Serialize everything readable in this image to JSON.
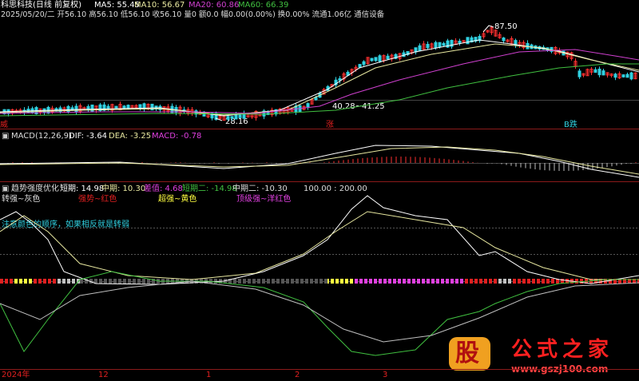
{
  "header": {
    "title": "科思科技(日线 前复权)",
    "ma5": "MA5: 55.45",
    "ma10": "MA10: 56.67",
    "ma20": "MA20: 60.86",
    "ma60": "MA60: 66.39",
    "info": "2025/05/20/二 开56.10 高56.10 低56.10 收56.10 量0 额0.0 幅0.00(0.00%) 换0.00% 流通1.06亿 通信设备"
  },
  "price_panel": {
    "high_label": "87.50",
    "mid_label": "40.28~41.25",
    "low_label": "28.16",
    "sig1": "威",
    "sig2": "涨",
    "sig3": "B跌"
  },
  "macd_panel": {
    "title": "MACD(12,26,9)",
    "dif": "DIF: -3.64",
    "dea": "DEA: -3.25",
    "macd": "MACD: -0.78"
  },
  "trend_panel": {
    "title": "趋势强度优化",
    "short": "短期: 14.98",
    "mid": "中期: 10.30",
    "diff": "差值: 4.68",
    "short2": "短期二: -14.98",
    "mid2": "中期二: -10.30",
    "levels": "100.00 : 200.00",
    "legend1": "转强~灰色",
    "legend2": "强势~红色",
    "legend3": "超强~黄色",
    "legend4": "顶级强~洋红色",
    "note": "注意颜色的顺序，如果相反就是转弱"
  },
  "x_axis": [
    "2024年",
    "12",
    "1",
    "2",
    "3"
  ],
  "watermark": {
    "logo": "股",
    "name": "公式之家",
    "url": "www.gszj100.com"
  },
  "colors": {
    "ma5": "#ffffff",
    "ma10": "#e8e8a0",
    "ma20": "#d040d0",
    "ma60": "#40c040",
    "up": "#ff3030",
    "down": "#30d0e0",
    "magenta": "#e040e0",
    "yellow": "#ffff40",
    "gray": "#c0c0c0",
    "red": "#e02020"
  },
  "chart_data": {
    "type": "line",
    "title": "科思科技(日线 前复权)",
    "x": [
      "2024年",
      "12",
      "1",
      "2",
      "3"
    ],
    "series": [
      {
        "name": "MA5",
        "values": [
          55.45
        ]
      },
      {
        "name": "MA10",
        "values": [
          56.67
        ]
      },
      {
        "name": "MA20",
        "values": [
          60.86
        ]
      },
      {
        "name": "MA60",
        "values": [
          66.39
        ]
      },
      {
        "name": "DIF",
        "values": [
          -3.64
        ]
      },
      {
        "name": "DEA",
        "values": [
          -3.25
        ]
      },
      {
        "name": "MACD",
        "values": [
          -0.78
        ]
      }
    ],
    "price_high": 87.5,
    "price_low": 28.16,
    "price_band": [
      40.28,
      41.25
    ]
  }
}
